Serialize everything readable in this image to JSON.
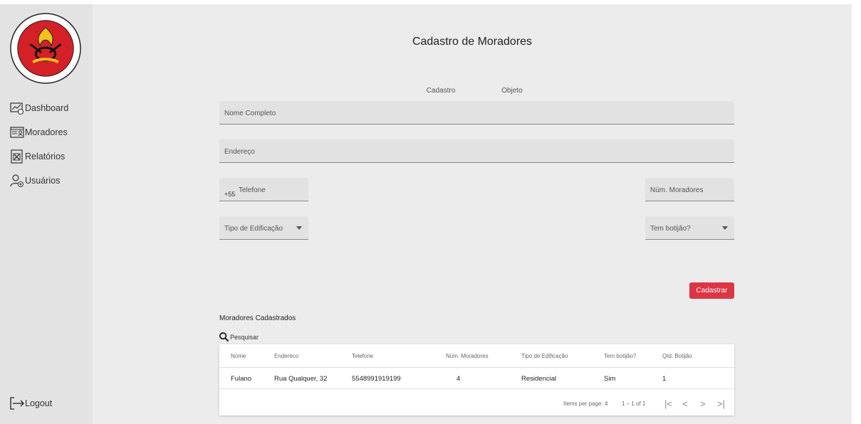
{
  "sidebar": {
    "logo_text": [
      "CORPO DE BOMBEIROS MILITAR",
      "SANTA CATARINA"
    ],
    "items": [
      {
        "label": "Dashboard",
        "icon": "dashboard-icon"
      },
      {
        "label": "Moradores",
        "icon": "id-card-icon"
      },
      {
        "label": "Relatórios",
        "icon": "excel-file-icon"
      },
      {
        "label": "Usuários",
        "icon": "add-user-icon"
      }
    ],
    "logout": {
      "label": "Logout",
      "icon": "logout-icon"
    }
  },
  "page": {
    "title": "Cadastro de Moradores"
  },
  "tabs": [
    {
      "label": "Cadastro",
      "active": true
    },
    {
      "label": "Objeto",
      "active": false
    }
  ],
  "form": {
    "nome": {
      "placeholder": "Nome Completo"
    },
    "endereco": {
      "placeholder": "Endereço"
    },
    "telefone": {
      "prefix": "+55",
      "placeholder": "Telefone"
    },
    "num_moradores": {
      "placeholder": "Núm. Moradores"
    },
    "tipo_edificacao": {
      "placeholder": "Tipo de Edificação"
    },
    "tem_botijao": {
      "placeholder": "Tem botijão?"
    },
    "submit_label": "Cadastrar"
  },
  "list": {
    "title": "Moradores Cadastrados",
    "search_label": "Pesquisar",
    "columns": [
      "Nome",
      "Endereco",
      "Telefone",
      "Núm. Moradores",
      "Tipo de Edificação",
      "Tem botijão?",
      "Qtd. Botijão"
    ],
    "rows": [
      [
        "Fulano",
        "Rua Qualquer, 32",
        "5548991919199",
        "4",
        "Residencial",
        "Sim",
        "1"
      ]
    ],
    "paginator": {
      "items_per_page_label": "Items per page:",
      "items_per_page": "4",
      "range": "1 – 1 of 1"
    }
  },
  "colors": {
    "accent": "#3f51b5",
    "primary_button": "#dc3545",
    "sidebar_bg": "#e3e3e3",
    "main_bg": "#ececec"
  }
}
